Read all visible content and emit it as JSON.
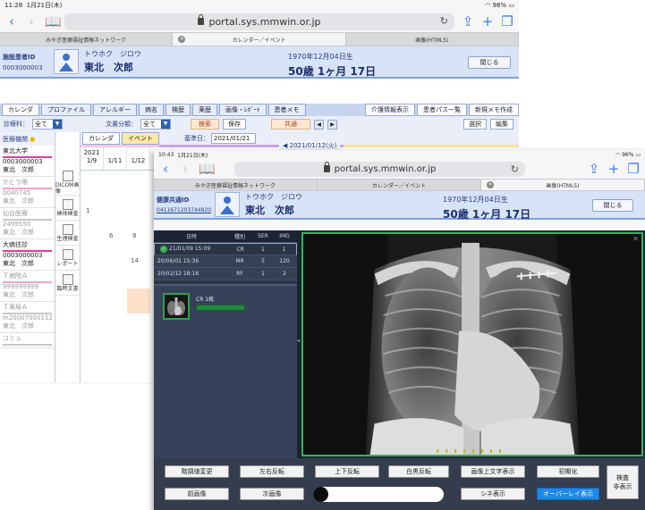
{
  "back": {
    "status": {
      "time": "11:28",
      "date": "1月21日(木)",
      "battery": "98%"
    },
    "url": "portal.sys.mmwin.or.jp",
    "tabs": [
      {
        "label": "みやぎ医療福祉情報ネットワーク",
        "active": false
      },
      {
        "label": "カレンダー／イベント",
        "active": true
      },
      {
        "label": "画像(HTML5)",
        "active": false
      }
    ],
    "patient": {
      "id_label": "施設患者ID",
      "id_value": "0003000003",
      "kana": "トウホク　ジロウ",
      "name": "東北　次郎",
      "dob": "1970年12月04日生",
      "age": "50歳 1ヶ月 17日",
      "close_label": "閉じる"
    },
    "menu_tabs": [
      "カレンダ",
      "プロファイル",
      "アレルギー",
      "病名",
      "検歴",
      "薬歴",
      "画像・ﾚﾎﾟｰﾄ",
      "患者メモ"
    ],
    "menu_right": [
      "介護情報表示",
      "患者パス一覧",
      "新規メモ作成"
    ],
    "filter": {
      "dept_label": "診療科：",
      "dept_value": "全て",
      "doc_label": "文書分類：",
      "doc_value": "全て",
      "search": "検索",
      "save": "保存",
      "shared": "共通",
      "select": "選択",
      "edit": "編集"
    },
    "sidebar": {
      "header": "医療機関",
      "items": [
        {
          "name": "東北大学",
          "id": "0003000003",
          "pname": "東北　次郎",
          "color": "#e8399a",
          "muted": false
        },
        {
          "name": "かとう眼",
          "id": "0040745",
          "pname": "東北　次郎",
          "color": "#f0a3c8",
          "muted": true
        },
        {
          "name": "仙台医療",
          "id": "2499550",
          "pname": "東北　次郎",
          "color": "#c7c7c7",
          "muted": true
        },
        {
          "name": "大病往診",
          "id": "0003000003",
          "pname": "東北　次郎",
          "color": "#e8399a",
          "muted": false
        },
        {
          "name": "Ｔ病院Ａ",
          "id": "999999999",
          "pname": "東北　次郎",
          "color": "#f0a3c8",
          "muted": true
        },
        {
          "name": "Ｔ薬局Ａ",
          "id": "m20007000112",
          "pname": "東北　次郎",
          "color": "#c7c7c7",
          "muted": true
        },
        {
          "name": "コミュ",
          "id": "",
          "pname": "",
          "color": "#c7c7c7",
          "muted": true
        }
      ]
    },
    "categories": [
      {
        "label": "DICOM画像"
      },
      {
        "label": "検体検査"
      },
      {
        "label": "生理検査"
      },
      {
        "label": "レポート"
      },
      {
        "label": "臨時文書"
      }
    ],
    "grid": {
      "tab_calendar": "カレンダ",
      "tab_event": "イベント",
      "base_date_label": "基準日：",
      "base_date": "2021/01/21",
      "range": "2021/01/12(火)",
      "year": "2021",
      "dates": [
        "1/9",
        "1/11",
        "1/12",
        "1/"
      ],
      "counts": [
        "1",
        "6",
        "8",
        "14"
      ]
    }
  },
  "front": {
    "status": {
      "time": "10:43",
      "date": "1月21日(木)",
      "battery": "96%"
    },
    "url": "portal.sys.mmwin.or.jp",
    "tabs": [
      {
        "label": "みやぎ医療福祉情報ネットワーク",
        "active": false
      },
      {
        "label": "カレンダー／イベント",
        "active": false
      },
      {
        "label": "画像(HTML5)",
        "active": true
      }
    ],
    "patient": {
      "id_label": "健康共通ID",
      "id_value": "04116712037448​20",
      "kana": "トウホク　ジロウ",
      "name": "東北　次郎",
      "dob": "1970年12月04日生",
      "age": "50歳 1ヶ月 17日",
      "close_label": "閉じる"
    },
    "study_headers": [
      "日時",
      "種別",
      "SER",
      "IMG"
    ],
    "studies": [
      {
        "date": "21/01/09 15:09",
        "modality": "CR",
        "ser": "1",
        "img": "1",
        "ok": true
      },
      {
        "date": "20/06/01 15:36",
        "modality": "MR",
        "ser": "5",
        "img": "120",
        "ok": false
      },
      {
        "date": "20/02/12 18:16",
        "modality": "RF",
        "ser": "1",
        "img": "2",
        "ok": false
      }
    ],
    "series_label": "CR 1枚",
    "toolbar": {
      "row1": [
        "階調値変更",
        "左右反転",
        "上下反転",
        "白黒反転",
        "画像上文字表示",
        "初期化"
      ],
      "row2": [
        "前画像",
        "次画像",
        "シネ表示",
        "オーバーレイ表示"
      ],
      "side": [
        "検査",
        "非表示"
      ],
      "slider_value": 0
    }
  }
}
